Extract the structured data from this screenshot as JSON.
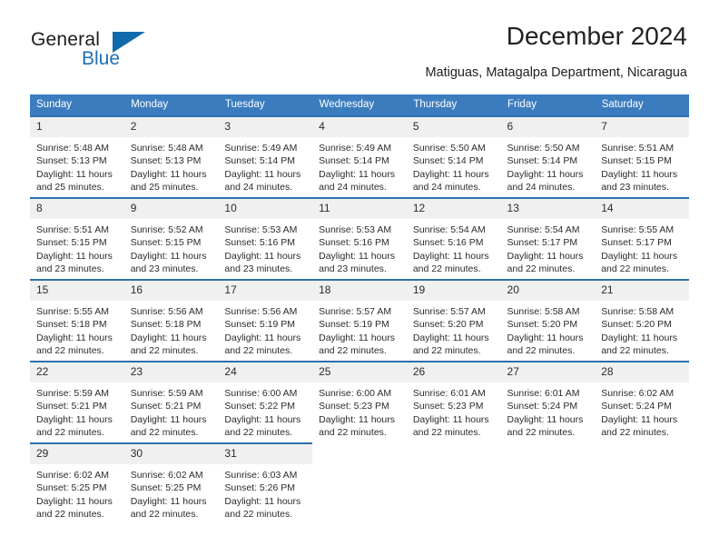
{
  "brand": {
    "name_top": "General",
    "name_bottom": "Blue",
    "triangle_icon": "triangle-icon",
    "accent_color": "#1f6fb2"
  },
  "header": {
    "title": "December 2024",
    "subtitle": "Matiguas, Matagalpa Department, Nicaragua"
  },
  "theme": {
    "header_bg": "#3b7cbe",
    "row_border": "#2f6fb0",
    "daynum_bg": "#f0f0f0",
    "text": "#2b2b2b"
  },
  "calendar": {
    "columns": [
      "Sunday",
      "Monday",
      "Tuesday",
      "Wednesday",
      "Thursday",
      "Friday",
      "Saturday"
    ],
    "labels": {
      "sunrise": "Sunrise:",
      "sunset": "Sunset:",
      "daylight": "Daylight:"
    },
    "weeks": [
      [
        {
          "day": "1",
          "sunrise": "Sunrise: 5:48 AM",
          "sunset": "Sunset: 5:13 PM",
          "daylight_line1": "Daylight: 11 hours",
          "daylight_line2": "and 25 minutes."
        },
        {
          "day": "2",
          "sunrise": "Sunrise: 5:48 AM",
          "sunset": "Sunset: 5:13 PM",
          "daylight_line1": "Daylight: 11 hours",
          "daylight_line2": "and 25 minutes."
        },
        {
          "day": "3",
          "sunrise": "Sunrise: 5:49 AM",
          "sunset": "Sunset: 5:14 PM",
          "daylight_line1": "Daylight: 11 hours",
          "daylight_line2": "and 24 minutes."
        },
        {
          "day": "4",
          "sunrise": "Sunrise: 5:49 AM",
          "sunset": "Sunset: 5:14 PM",
          "daylight_line1": "Daylight: 11 hours",
          "daylight_line2": "and 24 minutes."
        },
        {
          "day": "5",
          "sunrise": "Sunrise: 5:50 AM",
          "sunset": "Sunset: 5:14 PM",
          "daylight_line1": "Daylight: 11 hours",
          "daylight_line2": "and 24 minutes."
        },
        {
          "day": "6",
          "sunrise": "Sunrise: 5:50 AM",
          "sunset": "Sunset: 5:14 PM",
          "daylight_line1": "Daylight: 11 hours",
          "daylight_line2": "and 24 minutes."
        },
        {
          "day": "7",
          "sunrise": "Sunrise: 5:51 AM",
          "sunset": "Sunset: 5:15 PM",
          "daylight_line1": "Daylight: 11 hours",
          "daylight_line2": "and 23 minutes."
        }
      ],
      [
        {
          "day": "8",
          "sunrise": "Sunrise: 5:51 AM",
          "sunset": "Sunset: 5:15 PM",
          "daylight_line1": "Daylight: 11 hours",
          "daylight_line2": "and 23 minutes."
        },
        {
          "day": "9",
          "sunrise": "Sunrise: 5:52 AM",
          "sunset": "Sunset: 5:15 PM",
          "daylight_line1": "Daylight: 11 hours",
          "daylight_line2": "and 23 minutes."
        },
        {
          "day": "10",
          "sunrise": "Sunrise: 5:53 AM",
          "sunset": "Sunset: 5:16 PM",
          "daylight_line1": "Daylight: 11 hours",
          "daylight_line2": "and 23 minutes."
        },
        {
          "day": "11",
          "sunrise": "Sunrise: 5:53 AM",
          "sunset": "Sunset: 5:16 PM",
          "daylight_line1": "Daylight: 11 hours",
          "daylight_line2": "and 23 minutes."
        },
        {
          "day": "12",
          "sunrise": "Sunrise: 5:54 AM",
          "sunset": "Sunset: 5:16 PM",
          "daylight_line1": "Daylight: 11 hours",
          "daylight_line2": "and 22 minutes."
        },
        {
          "day": "13",
          "sunrise": "Sunrise: 5:54 AM",
          "sunset": "Sunset: 5:17 PM",
          "daylight_line1": "Daylight: 11 hours",
          "daylight_line2": "and 22 minutes."
        },
        {
          "day": "14",
          "sunrise": "Sunrise: 5:55 AM",
          "sunset": "Sunset: 5:17 PM",
          "daylight_line1": "Daylight: 11 hours",
          "daylight_line2": "and 22 minutes."
        }
      ],
      [
        {
          "day": "15",
          "sunrise": "Sunrise: 5:55 AM",
          "sunset": "Sunset: 5:18 PM",
          "daylight_line1": "Daylight: 11 hours",
          "daylight_line2": "and 22 minutes."
        },
        {
          "day": "16",
          "sunrise": "Sunrise: 5:56 AM",
          "sunset": "Sunset: 5:18 PM",
          "daylight_line1": "Daylight: 11 hours",
          "daylight_line2": "and 22 minutes."
        },
        {
          "day": "17",
          "sunrise": "Sunrise: 5:56 AM",
          "sunset": "Sunset: 5:19 PM",
          "daylight_line1": "Daylight: 11 hours",
          "daylight_line2": "and 22 minutes."
        },
        {
          "day": "18",
          "sunrise": "Sunrise: 5:57 AM",
          "sunset": "Sunset: 5:19 PM",
          "daylight_line1": "Daylight: 11 hours",
          "daylight_line2": "and 22 minutes."
        },
        {
          "day": "19",
          "sunrise": "Sunrise: 5:57 AM",
          "sunset": "Sunset: 5:20 PM",
          "daylight_line1": "Daylight: 11 hours",
          "daylight_line2": "and 22 minutes."
        },
        {
          "day": "20",
          "sunrise": "Sunrise: 5:58 AM",
          "sunset": "Sunset: 5:20 PM",
          "daylight_line1": "Daylight: 11 hours",
          "daylight_line2": "and 22 minutes."
        },
        {
          "day": "21",
          "sunrise": "Sunrise: 5:58 AM",
          "sunset": "Sunset: 5:20 PM",
          "daylight_line1": "Daylight: 11 hours",
          "daylight_line2": "and 22 minutes."
        }
      ],
      [
        {
          "day": "22",
          "sunrise": "Sunrise: 5:59 AM",
          "sunset": "Sunset: 5:21 PM",
          "daylight_line1": "Daylight: 11 hours",
          "daylight_line2": "and 22 minutes."
        },
        {
          "day": "23",
          "sunrise": "Sunrise: 5:59 AM",
          "sunset": "Sunset: 5:21 PM",
          "daylight_line1": "Daylight: 11 hours",
          "daylight_line2": "and 22 minutes."
        },
        {
          "day": "24",
          "sunrise": "Sunrise: 6:00 AM",
          "sunset": "Sunset: 5:22 PM",
          "daylight_line1": "Daylight: 11 hours",
          "daylight_line2": "and 22 minutes."
        },
        {
          "day": "25",
          "sunrise": "Sunrise: 6:00 AM",
          "sunset": "Sunset: 5:23 PM",
          "daylight_line1": "Daylight: 11 hours",
          "daylight_line2": "and 22 minutes."
        },
        {
          "day": "26",
          "sunrise": "Sunrise: 6:01 AM",
          "sunset": "Sunset: 5:23 PM",
          "daylight_line1": "Daylight: 11 hours",
          "daylight_line2": "and 22 minutes."
        },
        {
          "day": "27",
          "sunrise": "Sunrise: 6:01 AM",
          "sunset": "Sunset: 5:24 PM",
          "daylight_line1": "Daylight: 11 hours",
          "daylight_line2": "and 22 minutes."
        },
        {
          "day": "28",
          "sunrise": "Sunrise: 6:02 AM",
          "sunset": "Sunset: 5:24 PM",
          "daylight_line1": "Daylight: 11 hours",
          "daylight_line2": "and 22 minutes."
        }
      ],
      [
        {
          "day": "29",
          "sunrise": "Sunrise: 6:02 AM",
          "sunset": "Sunset: 5:25 PM",
          "daylight_line1": "Daylight: 11 hours",
          "daylight_line2": "and 22 minutes."
        },
        {
          "day": "30",
          "sunrise": "Sunrise: 6:02 AM",
          "sunset": "Sunset: 5:25 PM",
          "daylight_line1": "Daylight: 11 hours",
          "daylight_line2": "and 22 minutes."
        },
        {
          "day": "31",
          "sunrise": "Sunrise: 6:03 AM",
          "sunset": "Sunset: 5:26 PM",
          "daylight_line1": "Daylight: 11 hours",
          "daylight_line2": "and 22 minutes."
        },
        {
          "day": "",
          "sunrise": "",
          "sunset": "",
          "daylight_line1": "",
          "daylight_line2": "",
          "empty": true
        },
        {
          "day": "",
          "sunrise": "",
          "sunset": "",
          "daylight_line1": "",
          "daylight_line2": "",
          "empty": true
        },
        {
          "day": "",
          "sunrise": "",
          "sunset": "",
          "daylight_line1": "",
          "daylight_line2": "",
          "empty": true
        },
        {
          "day": "",
          "sunrise": "",
          "sunset": "",
          "daylight_line1": "",
          "daylight_line2": "",
          "empty": true
        }
      ]
    ]
  }
}
